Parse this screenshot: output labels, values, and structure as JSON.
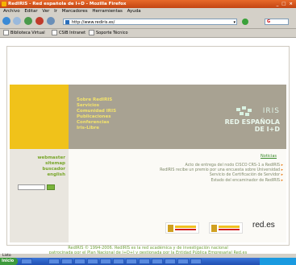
{
  "window": {
    "title": "RedIRIS - Red española de I+D - Mozilla Firefox",
    "controls": "_ □ ×"
  },
  "menu": [
    "Archivo",
    "Editar",
    "Ver",
    "Ir",
    "Marcadores",
    "Herramientas",
    "Ayuda"
  ],
  "toolbar": {
    "url": "http://www.rediris.es/",
    "search_engine": "G"
  },
  "bookmarks": [
    "Biblioteca Virtual",
    "CSIB Intranet",
    "Soporte Técnico"
  ],
  "site": {
    "nav": [
      "Sobre RedIRIS",
      "Servicios",
      "Comunidad IRIS",
      "Publicaciones",
      "Conferencias",
      "Iris-Libre"
    ],
    "brand": {
      "iris": "IRIS",
      "line1": "RED ESPAÑOLA",
      "line2": "DE I+D"
    },
    "side_links": [
      "webmaster",
      "sitemap",
      "buscador",
      "english"
    ],
    "news_title": "Noticias",
    "news": [
      "Acto de entrega del nodo CISCO CRS-1 a RedIRIS",
      "RedIRIS recibe un premio por una encuesta sobre Universidad",
      "Servicio de Certificación de Servidor",
      "Estado del encaminador de RedIRIS"
    ],
    "redes": "red.es",
    "footer_line1": "RedIRIS © 1994-2006. RedIRIS es la red académica y de investigación nacional",
    "footer_line2": "patrocinada por el Plan Nacional de I+D+I y gestionada por la Entidad Pública Empresarial Red.es"
  },
  "status": "Listo",
  "taskbar": {
    "start": "Inicio"
  },
  "colors": {
    "accent_yellow": "#f0c21a",
    "header_gray": "#a8a292",
    "link_green": "#78a62a"
  }
}
